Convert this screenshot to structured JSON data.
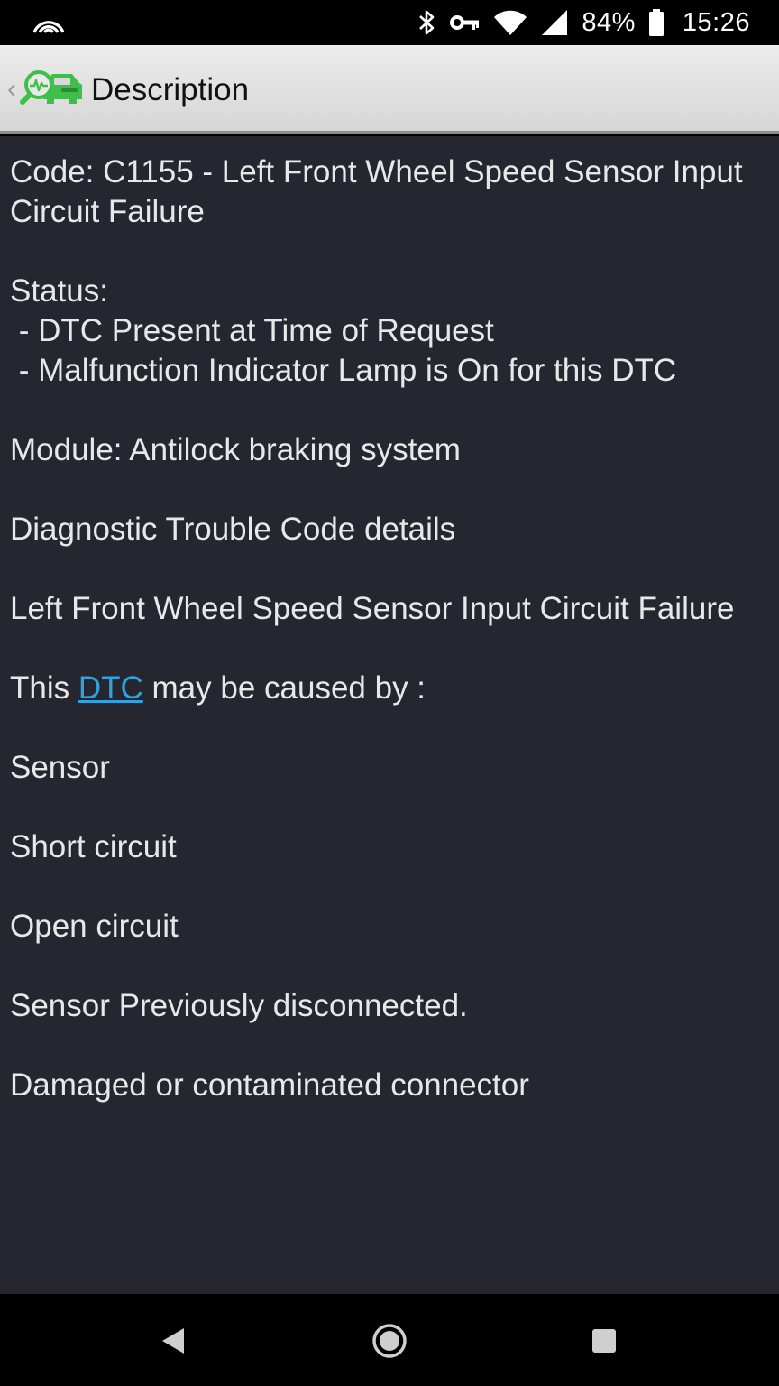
{
  "status_bar": {
    "icons": [
      "hotspot-icon",
      "bluetooth-icon",
      "vpn-key-icon",
      "wifi-icon",
      "signal-icon",
      "battery-icon"
    ],
    "battery_percent": "84%",
    "time": "15:26"
  },
  "action_bar": {
    "title": "Description",
    "logo_icon": "car-diagnostic-logo-icon",
    "back_icon": "chevron-left-icon"
  },
  "content": {
    "code_line": "Code: C1155 - Left Front Wheel Speed Sensor Input Circuit Failure",
    "status_label": "Status:",
    "status_items": [
      " - DTC Present at Time of Request",
      " - Malfunction Indicator Lamp is On for this DTC"
    ],
    "module": "Module: Antilock braking system",
    "details_heading": "Diagnostic Trouble Code details",
    "description": "Left Front Wheel Speed Sensor Input Circuit Failure",
    "cause_prefix": "This ",
    "cause_link": "DTC",
    "cause_suffix": " may be caused by :",
    "causes": [
      "Sensor",
      "Short circuit",
      "Open circuit",
      "Sensor Previously disconnected.",
      "Damaged or contaminated connector"
    ]
  },
  "nav_bar": {
    "icons": [
      "nav-back-icon",
      "nav-home-icon",
      "nav-recents-icon"
    ]
  },
  "colors": {
    "content_bg": "#262630",
    "text": "#e8e8e8",
    "link": "#2fa3e0",
    "logo_green": "#3fbf4a"
  }
}
